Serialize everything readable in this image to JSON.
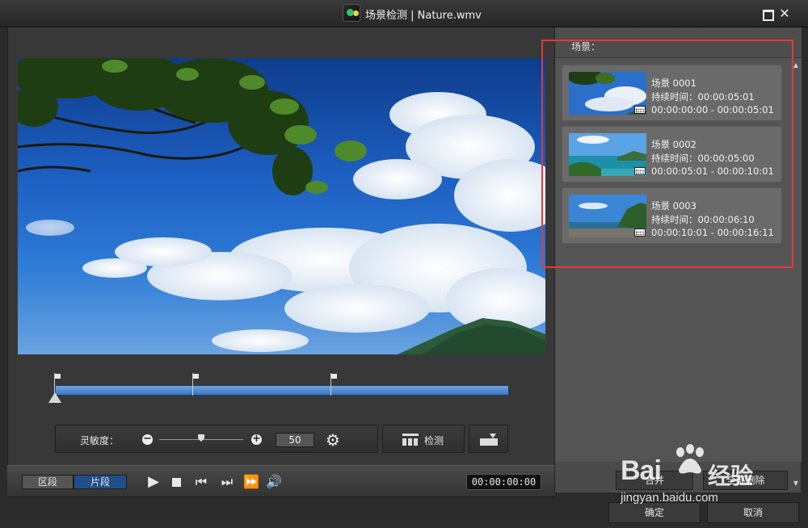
{
  "window": {
    "title": "场景检测 | Nature.wmv",
    "app_icon": "film-camera-icon",
    "maximize_icon": "maximize-icon",
    "close_icon": "close-icon",
    "close_glyph": "✕"
  },
  "sensitivity": {
    "label": "灵敏度：",
    "value": "50",
    "level": 50
  },
  "toolbar": {
    "detect_label": "检测"
  },
  "playback": {
    "tabs": [
      "区段",
      "片段"
    ],
    "active_tab": "片段",
    "time": "00:00:00:00"
  },
  "scenes": {
    "header": "场景：",
    "items": [
      {
        "title": "场景 0001",
        "duration": "持续时间：00:00:05:01",
        "range": "00:00:00:00 - 00:00:05:01"
      },
      {
        "title": "场景 0002",
        "duration": "持续时间：00:00:05:00",
        "range": "00:00:05:01 - 00:00:10:01"
      },
      {
        "title": "场景 0003",
        "duration": "持续时间：00:00:06:10",
        "range": "00:00:10:01 - 00:00:16:11"
      }
    ],
    "merge_label": "合并",
    "delete_all_label": "全部删除"
  },
  "dialog": {
    "ok_label": "确定",
    "cancel_label": "取消"
  },
  "watermark": {
    "brand": "Baidu经验",
    "url": "jingyan.baidu.com"
  },
  "colors": {
    "accent_blue": "#1f4f8a",
    "highlight_red": "#e23a3a",
    "timeline": "#3a77c0"
  }
}
